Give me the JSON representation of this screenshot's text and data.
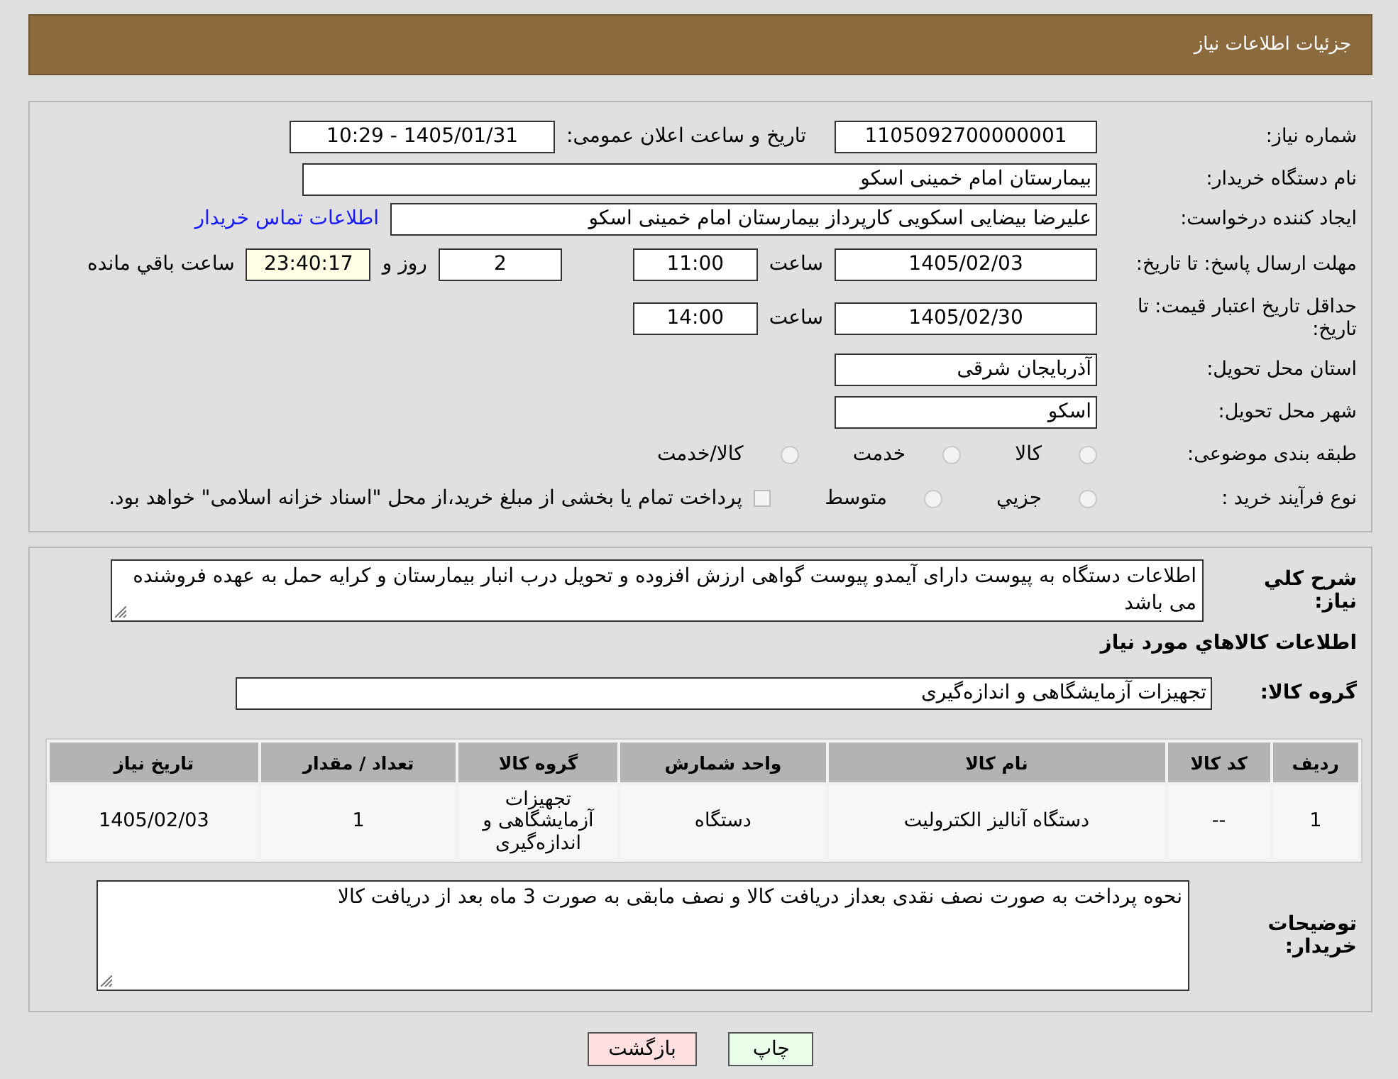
{
  "header": {
    "title": "جزئیات اطلاعات نیاز"
  },
  "need_number": {
    "label": "شماره نیاز:",
    "value": "1105092700000001"
  },
  "announce": {
    "label": "تاریخ و ساعت اعلان عمومی:",
    "value": "1405/01/31 - 10:29"
  },
  "buyer_org": {
    "label": "نام دستگاه خریدار:",
    "value": "بیمارستان امام خمینی اسکو"
  },
  "requester": {
    "label": "ایجاد کننده درخواست:",
    "value": "علیرضا بیضایی اسکویی کارپرداز بیمارستان امام خمینی اسکو",
    "link": "اطلاعات تماس خریدار"
  },
  "reply_deadline": {
    "label": "مهلت ارسال پاسخ: تا تاریخ:",
    "date": "1405/02/03",
    "time_label": "ساعت",
    "time": "11:00",
    "days": "2",
    "days_label": "روز و",
    "remaining": "23:40:17",
    "remaining_label": "ساعت باقي مانده"
  },
  "price_validity": {
    "label": "حداقل تاریخ اعتبار قیمت: تا تاریخ:",
    "date": "1405/02/30",
    "time_label": "ساعت",
    "time": "14:00"
  },
  "province": {
    "label": "استان محل تحویل:",
    "value": "آذربایجان شرقی"
  },
  "city": {
    "label": "شهر محل تحویل:",
    "value": "اسکو"
  },
  "category": {
    "label": "طبقه بندی موضوعی:",
    "options": [
      {
        "label": "کالا",
        "selected": false
      },
      {
        "label": "خدمت",
        "selected": false
      },
      {
        "label": "کالا/خدمت",
        "selected": false
      }
    ]
  },
  "purchase_type": {
    "label": "نوع فرآیند خرید :",
    "options": [
      {
        "label": "جزيي",
        "selected": false
      },
      {
        "label": "متوسط",
        "selected": false
      }
    ],
    "treasury": {
      "checked": false,
      "text": "پرداخت تمام یا بخشی از مبلغ خرید،از محل \"اسناد خزانه اسلامی\" خواهد بود."
    }
  },
  "description": {
    "label": "شرح کلي نیاز:",
    "value": "اطلاعات دستگاه به پیوست دارای آیمدو پیوست گواهی ارزش افزوده و تحویل درب انبار بیمارستان و کرایه حمل به عهده فروشنده می باشد"
  },
  "goods_title": "اطلاعات کالاهاي مورد نیاز",
  "goods_group": {
    "label": "گروه کالا:",
    "value": "تجهیزات آزمایشگاهی و اندازه‌گیری"
  },
  "table": {
    "columns": [
      "ردیف",
      "کد کالا",
      "نام کالا",
      "واحد شمارش",
      "گروه کالا",
      "تعداد / مقدار",
      "تاریخ نیاز"
    ],
    "rows": [
      [
        "1",
        "--",
        "دستگاه آنالیز الکترولیت",
        "دستگاه",
        "تجهیزات آزمایشگاهی و اندازه‌گیری",
        "1",
        "1405/02/03"
      ]
    ]
  },
  "buyer_notes": {
    "label": "توضیحات خریدار:",
    "value": "نحوه پرداخت به صورت نصف نقدی بعداز دریافت کالا و نصف مابقی به صورت 3 ماه بعد از دریافت کالا"
  },
  "buttons": [
    {
      "label": "چاپ",
      "kind": "print"
    },
    {
      "label": "بازگشت",
      "kind": "back"
    }
  ]
}
